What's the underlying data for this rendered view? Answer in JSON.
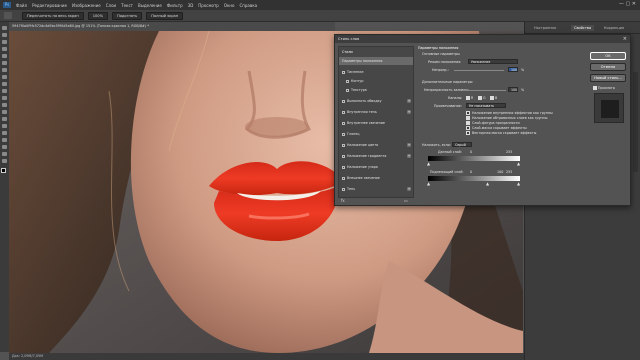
{
  "menubar": {
    "items": [
      "Файл",
      "Редактирование",
      "Изображение",
      "Слои",
      "Текст",
      "Выделение",
      "Фильтр",
      "3D",
      "Просмотр",
      "Окно",
      "Справка"
    ]
  },
  "options": {
    "items": [
      "Пересчитать на весь экран",
      "100%",
      "Подогнать",
      "Полный экран"
    ]
  },
  "document": {
    "tab": "5947f0a0f9fc572dc4d9bc5f90d5e80.jpg @ 151% (Тонкая красная 1, RGB/8#) *",
    "status": "Док: 2,09М/7,05М"
  },
  "panels": {
    "tabs": [
      "Настроения",
      "Свойства",
      "Коррекция"
    ]
  },
  "dialog": {
    "title": "Стиль слоя",
    "close": "×",
    "styles_header": "Стили",
    "fx": [
      {
        "label": "Параметры наложения",
        "active": true,
        "check": false,
        "plus": false
      },
      {
        "label": "Тиснение",
        "check": true,
        "plus": false
      },
      {
        "label": "Контур",
        "check": true,
        "plus": false
      },
      {
        "label": "Текстура",
        "check": true,
        "plus": false
      },
      {
        "label": "Выполнить обводку",
        "check": true,
        "plus": true
      },
      {
        "label": "Внутренняя тень",
        "check": true,
        "plus": true
      },
      {
        "label": "Внутреннее свечение",
        "check": true,
        "plus": false
      },
      {
        "label": "Глянец",
        "check": true,
        "plus": false
      },
      {
        "label": "Наложение цвета",
        "check": true,
        "plus": true
      },
      {
        "label": "Наложение градиента",
        "check": true,
        "plus": true
      },
      {
        "label": "Наложение узора",
        "check": true,
        "plus": false
      },
      {
        "label": "Внешнее свечение",
        "check": true,
        "plus": false
      },
      {
        "label": "Тень",
        "check": true,
        "plus": true
      }
    ],
    "fx_footer": "fx",
    "options": {
      "section": "Параметры наложения",
      "sub_basic": "Основные параметры",
      "blend_mode_label": "Режим наложения:",
      "blend_mode_value": "Умножение",
      "opacity_label": "Непрозр.:",
      "opacity_value": "100",
      "pct": "%",
      "advanced": "Дополнительные параметры",
      "fill_label": "Непрозрачность заливки:",
      "fill_value": "100",
      "channels_label": "Каналы:",
      "channels": [
        "R",
        "G",
        "B"
      ],
      "knockout_label": "Просвечивание:",
      "knockout_value": "Не показывать",
      "checks": [
        {
          "label": "Наложение внутренних эффектов как группы",
          "on": false
        },
        {
          "label": "Наложение обтравочных слоев как группы",
          "on": true
        },
        {
          "label": "Слой-фигура прозрачности",
          "on": true
        },
        {
          "label": "Слой-маска скрывает эффекты",
          "on": false
        },
        {
          "label": "Векторная маска скрывает эффекты",
          "on": false
        }
      ],
      "blendif_label": "Наложить, если:",
      "blendif_value": "Серый",
      "this_layer": "Данный слой:",
      "this_layer_values": [
        "0",
        "255"
      ],
      "under_layer": "Подлежащий слой:",
      "under_layer_values": [
        "0",
        "100",
        "255"
      ]
    },
    "buttons": [
      "OK",
      "Отмена",
      "Новый стиль...",
      "Просмотр"
    ]
  },
  "colors": {
    "lips": "#e2331f",
    "accent": "#ffffff"
  }
}
